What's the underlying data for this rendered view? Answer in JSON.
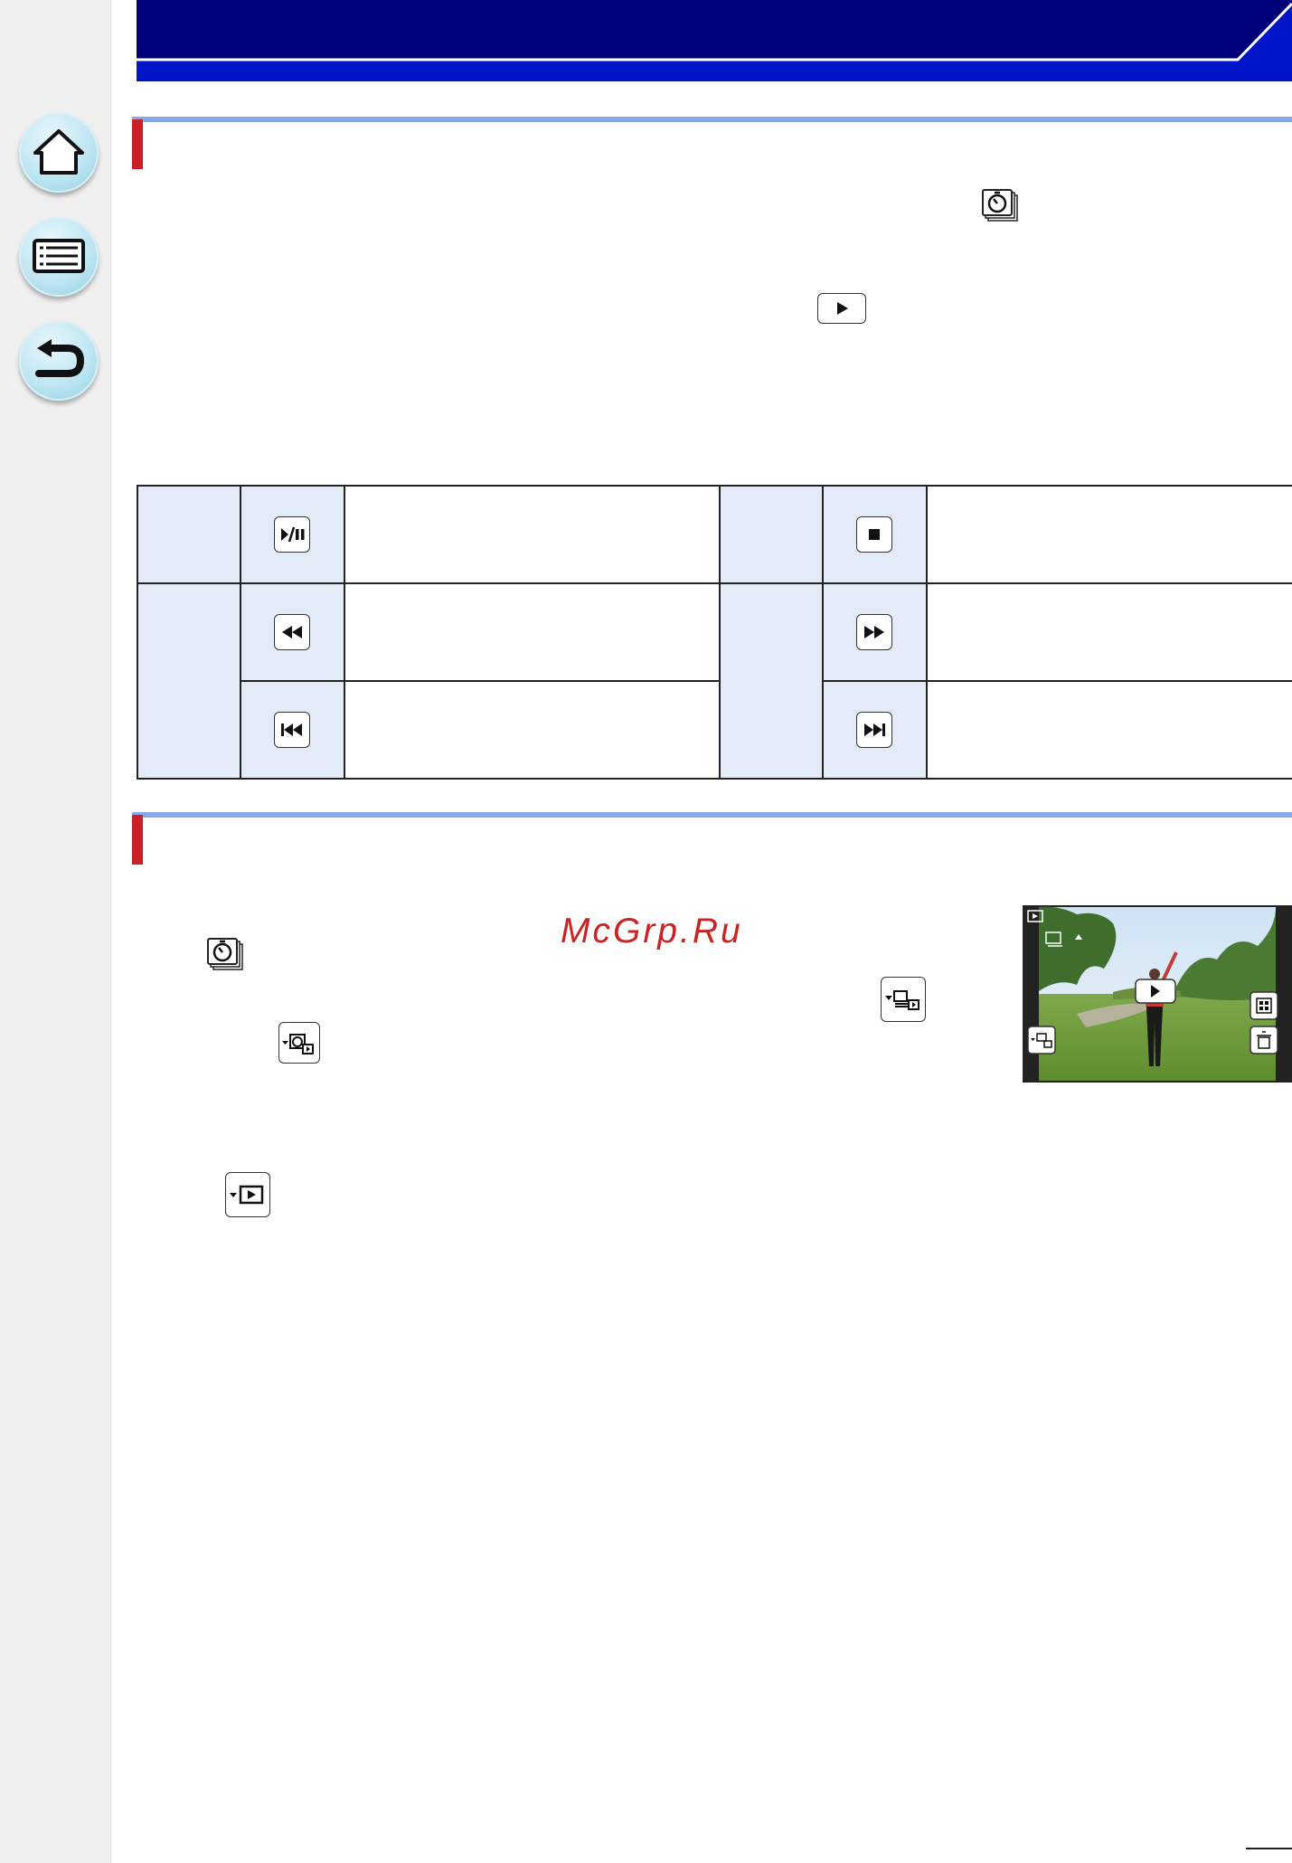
{
  "navigation": {
    "home": "home-icon",
    "contents": "list-icon",
    "back": "back-arrow-icon"
  },
  "watermark": "McGrp.Ru",
  "controls_table": {
    "rows": [
      {
        "left_icon": "play-pause-icon",
        "right_icon": "stop-icon"
      },
      {
        "left_icon": "rewind-icon",
        "right_icon": "fast-forward-icon"
      },
      {
        "left_icon": "skip-back-icon",
        "right_icon": "skip-forward-icon"
      }
    ]
  },
  "colors": {
    "header_blue": "#00007a",
    "header_stripe": "#0014c8",
    "section_line": "#88a8e8",
    "section_marker": "#cc1f2a",
    "table_fill": "#e3ebf7"
  }
}
